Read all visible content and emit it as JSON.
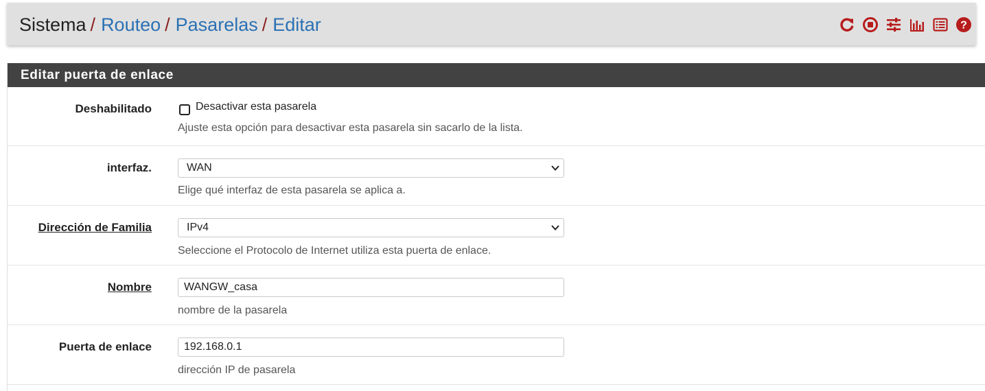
{
  "breadcrumb": {
    "root": "Sistema",
    "items": [
      "Routeo",
      "Pasarelas",
      "Editar"
    ],
    "separator": "/"
  },
  "header_icons": [
    "reload-icon",
    "stop-icon",
    "sliders-icon",
    "bar-chart-icon",
    "list-icon",
    "help-icon"
  ],
  "colors": {
    "accent": "#2a71b4",
    "icon_red": "#b71c1c",
    "panel_header": "#424242"
  },
  "panel": {
    "title": "Editar puerta de enlace"
  },
  "form": {
    "disabled": {
      "label": "Deshabilitado",
      "checkbox_label": "Desactivar esta pasarela",
      "checked": false,
      "help": "Ajuste esta opción para desactivar esta pasarela sin sacarlo de la lista."
    },
    "interface": {
      "label": "interfaz.",
      "value": "WAN",
      "help": "Elige qué interfaz de esta pasarela se aplica a."
    },
    "family": {
      "label": "Dirección de Familia",
      "value": "IPv4",
      "help": "Seleccione el Protocolo de Internet utiliza esta puerta de enlace."
    },
    "name": {
      "label": "Nombre",
      "value": "WANGW_casa",
      "help": "nombre de la pasarela"
    },
    "gateway": {
      "label": "Puerta de enlace",
      "value": "192.168.0.1",
      "help": "dirección IP de pasarela"
    }
  }
}
